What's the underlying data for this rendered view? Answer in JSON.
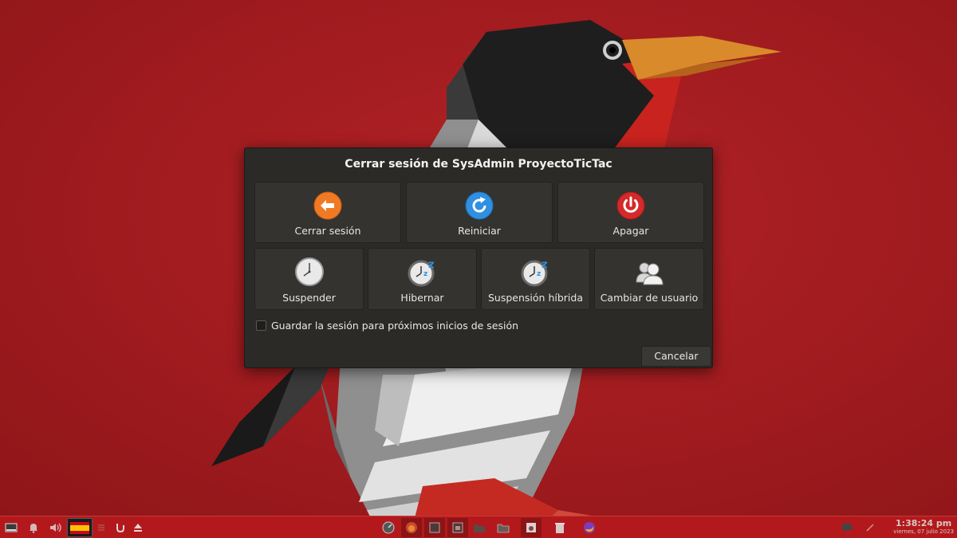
{
  "dialog": {
    "title": "Cerrar sesión de SysAdmin ProyectoTicTac",
    "actions_row1": [
      {
        "label": "Cerrar sesión",
        "icon": "logout-arrow-icon"
      },
      {
        "label": "Reiniciar",
        "icon": "restart-icon"
      },
      {
        "label": "Apagar",
        "icon": "power-icon"
      }
    ],
    "actions_row2": [
      {
        "label": "Suspender",
        "icon": "clock-icon"
      },
      {
        "label": "Hibernar",
        "icon": "clock-zz-icon"
      },
      {
        "label": "Suspensión híbrida",
        "icon": "clock-zz-icon"
      },
      {
        "label": "Cambiar de usuario",
        "icon": "users-icon"
      }
    ],
    "save_session_label": "Guardar la sesión para próximos inicios de sesión",
    "save_session_checked": false,
    "cancel_label": "Cancelar"
  },
  "taskbar": {
    "time": "1:38:24 pm",
    "date": "viernes, 07 julio 2023"
  },
  "colors": {
    "wallpaper": "#a31a1e",
    "dialog_bg": "#2c2a27",
    "button_bg": "#35332f",
    "logout_orange": "#f07a24",
    "restart_blue": "#2f8fe0",
    "power_red": "#d42a2a"
  }
}
